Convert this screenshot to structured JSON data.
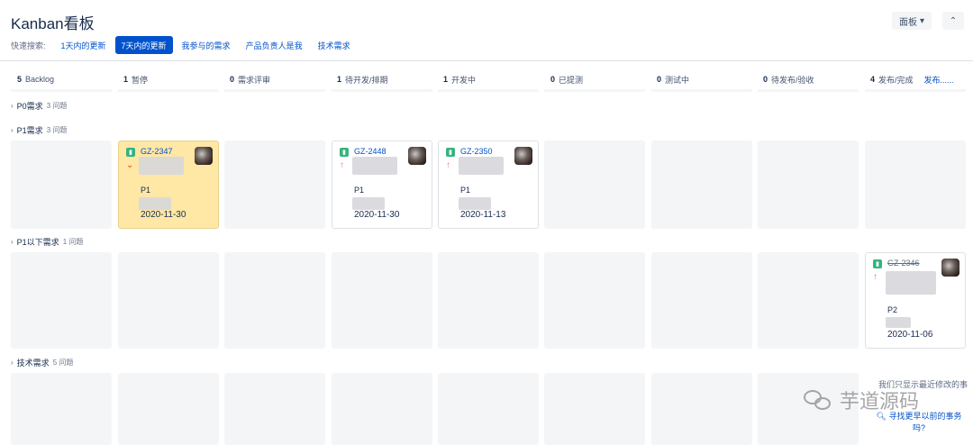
{
  "header": {
    "title": "Kanban看板",
    "board_button": "面板",
    "collapse_icon": "chevron-up-double-icon"
  },
  "quick_filters": {
    "label": "快速搜索:",
    "items": [
      "1天内的更新",
      "7天内的更新",
      "我参与的需求",
      "产品负责人是我",
      "技术需求"
    ],
    "active_index": 1
  },
  "columns": [
    {
      "count": "5",
      "name": "Backlog"
    },
    {
      "count": "1",
      "name": "暂停"
    },
    {
      "count": "0",
      "name": "需求评审"
    },
    {
      "count": "1",
      "name": "待开发/排期"
    },
    {
      "count": "1",
      "name": "开发中"
    },
    {
      "count": "0",
      "name": "已提测"
    },
    {
      "count": "0",
      "name": "测试中"
    },
    {
      "count": "0",
      "name": "待发布/验收"
    },
    {
      "count": "4",
      "name": "发布/完成"
    }
  ],
  "release_link": "发布......",
  "swimlanes": [
    {
      "name": "P0需求",
      "count": "3 问题"
    },
    {
      "name": "P1需求",
      "count": "3 问题"
    },
    {
      "name": "P1以下需求",
      "count": "1 问题"
    },
    {
      "name": "技术需求",
      "count": "5 问题"
    }
  ],
  "cards": [
    {
      "key": "GZ-2347",
      "priority": "P1",
      "date": "2020-11-30",
      "flagged": true
    },
    {
      "key": "GZ-2448",
      "priority": "P1",
      "date": "2020-11-30",
      "flagged": false
    },
    {
      "key": "GZ-2350",
      "priority": "P1",
      "date": "2020-11-13",
      "flagged": false
    },
    {
      "key": "GZ-2346",
      "priority": "P2",
      "date": "2020-11-06",
      "flagged": false
    }
  ],
  "footer": {
    "hint": "我们只显示最近修改的事",
    "find_older": "寻找更早以前的事务吗?",
    "watermark": "芋道源码"
  },
  "colors": {
    "accent": "#0052cc",
    "flag": "#ffe7a6",
    "story": "#36b37e"
  }
}
